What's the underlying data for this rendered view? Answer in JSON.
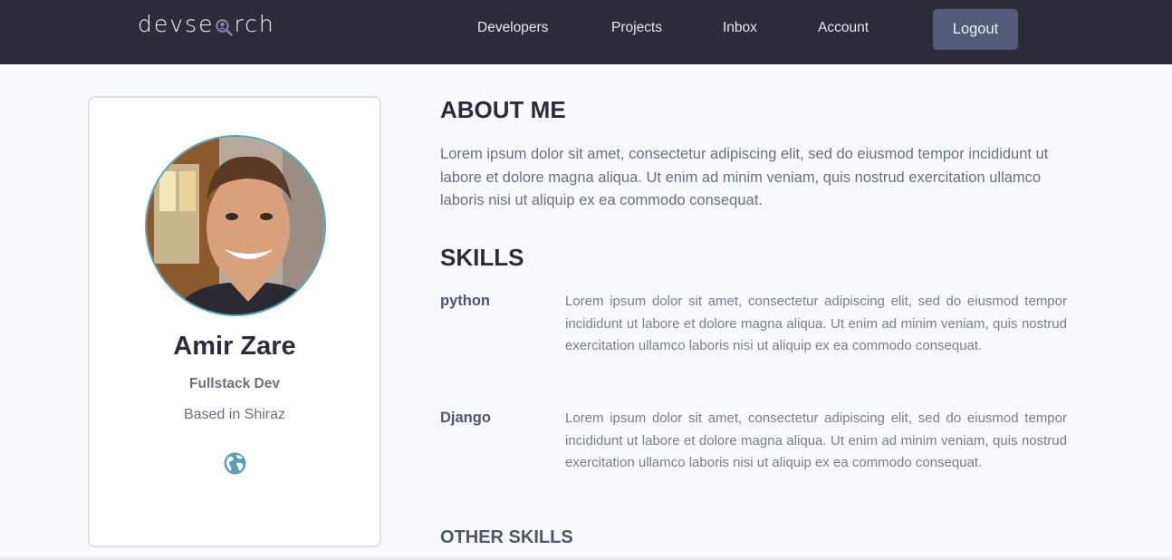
{
  "navbar": {
    "logo_text_left": "devse",
    "logo_text_right": "rch",
    "links": [
      "Developers",
      "Projects",
      "Inbox",
      "Account"
    ],
    "logout_label": "Logout"
  },
  "profile": {
    "name": "Amir Zare",
    "title": "Fullstack Dev",
    "location": "Based in Shiraz"
  },
  "about": {
    "heading": "ABOUT ME",
    "text": "Lorem ipsum dolor sit amet, consectetur adipiscing elit, sed do eiusmod tempor incididunt ut labore et dolore magna aliqua. Ut enim ad minim veniam, quis nostrud exercitation ullamco laboris nisi ut aliquip ex ea commodo consequat."
  },
  "skills": {
    "heading": "SKILLS",
    "items": [
      {
        "name": "python",
        "description": "Lorem ipsum dolor sit amet, consectetur adipiscing elit, sed do eiusmod tempor incididunt ut labore et dolore magna aliqua. Ut enim ad minim veniam, quis nostrud exercitation ullamco laboris nisi ut aliquip ex ea commodo consequat."
      },
      {
        "name": "Django",
        "description": "Lorem ipsum dolor sit amet, consectetur adipiscing elit, sed do eiusmod tempor incididunt ut labore et dolore magna aliqua. Ut enim ad minim veniam, quis nostrud exercitation ullamco laboris nisi ut aliquip ex ea commodo consequat."
      }
    ]
  },
  "other_skills": {
    "heading": "OTHER SKILLS"
  },
  "icons": {
    "logo_icon": "magnifier-person-icon",
    "website_icon": "globe-icon"
  },
  "colors": {
    "navbar_bg": "#2d2d39",
    "logout_bg": "#545a78",
    "accent": "#5aa5b9",
    "page_bg": "#f8f9fd"
  }
}
